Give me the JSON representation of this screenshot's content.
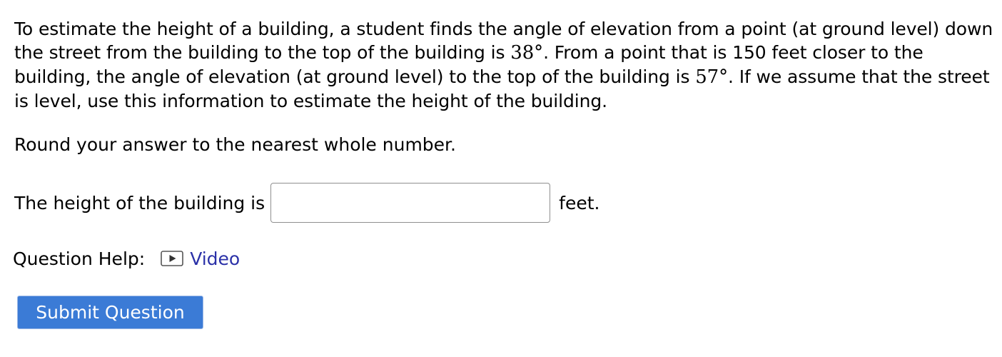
{
  "question": {
    "text_1": "To estimate the height of a building, a student finds the angle of elevation from a point (at ground level) down the street from the building to the top of the building is ",
    "angle_1": "38°",
    "text_2": ". From a point that is 150 feet closer to the building, the angle of elevation (at ground level) to the top of the building is ",
    "angle_2": "57°",
    "text_3": ". If we assume that the street is level, use this information to estimate the height of the building."
  },
  "instruction": "Round your answer to the nearest whole number.",
  "answer": {
    "prefix": "The height of the building is",
    "value": "",
    "placeholder": "",
    "suffix": "feet."
  },
  "help": {
    "label": "Question Help:",
    "video_label": "Video",
    "video_icon": "play-icon",
    "link_color": "#2b31a8"
  },
  "submit": {
    "label": "Submit Question",
    "color": "#3b7bd6"
  }
}
